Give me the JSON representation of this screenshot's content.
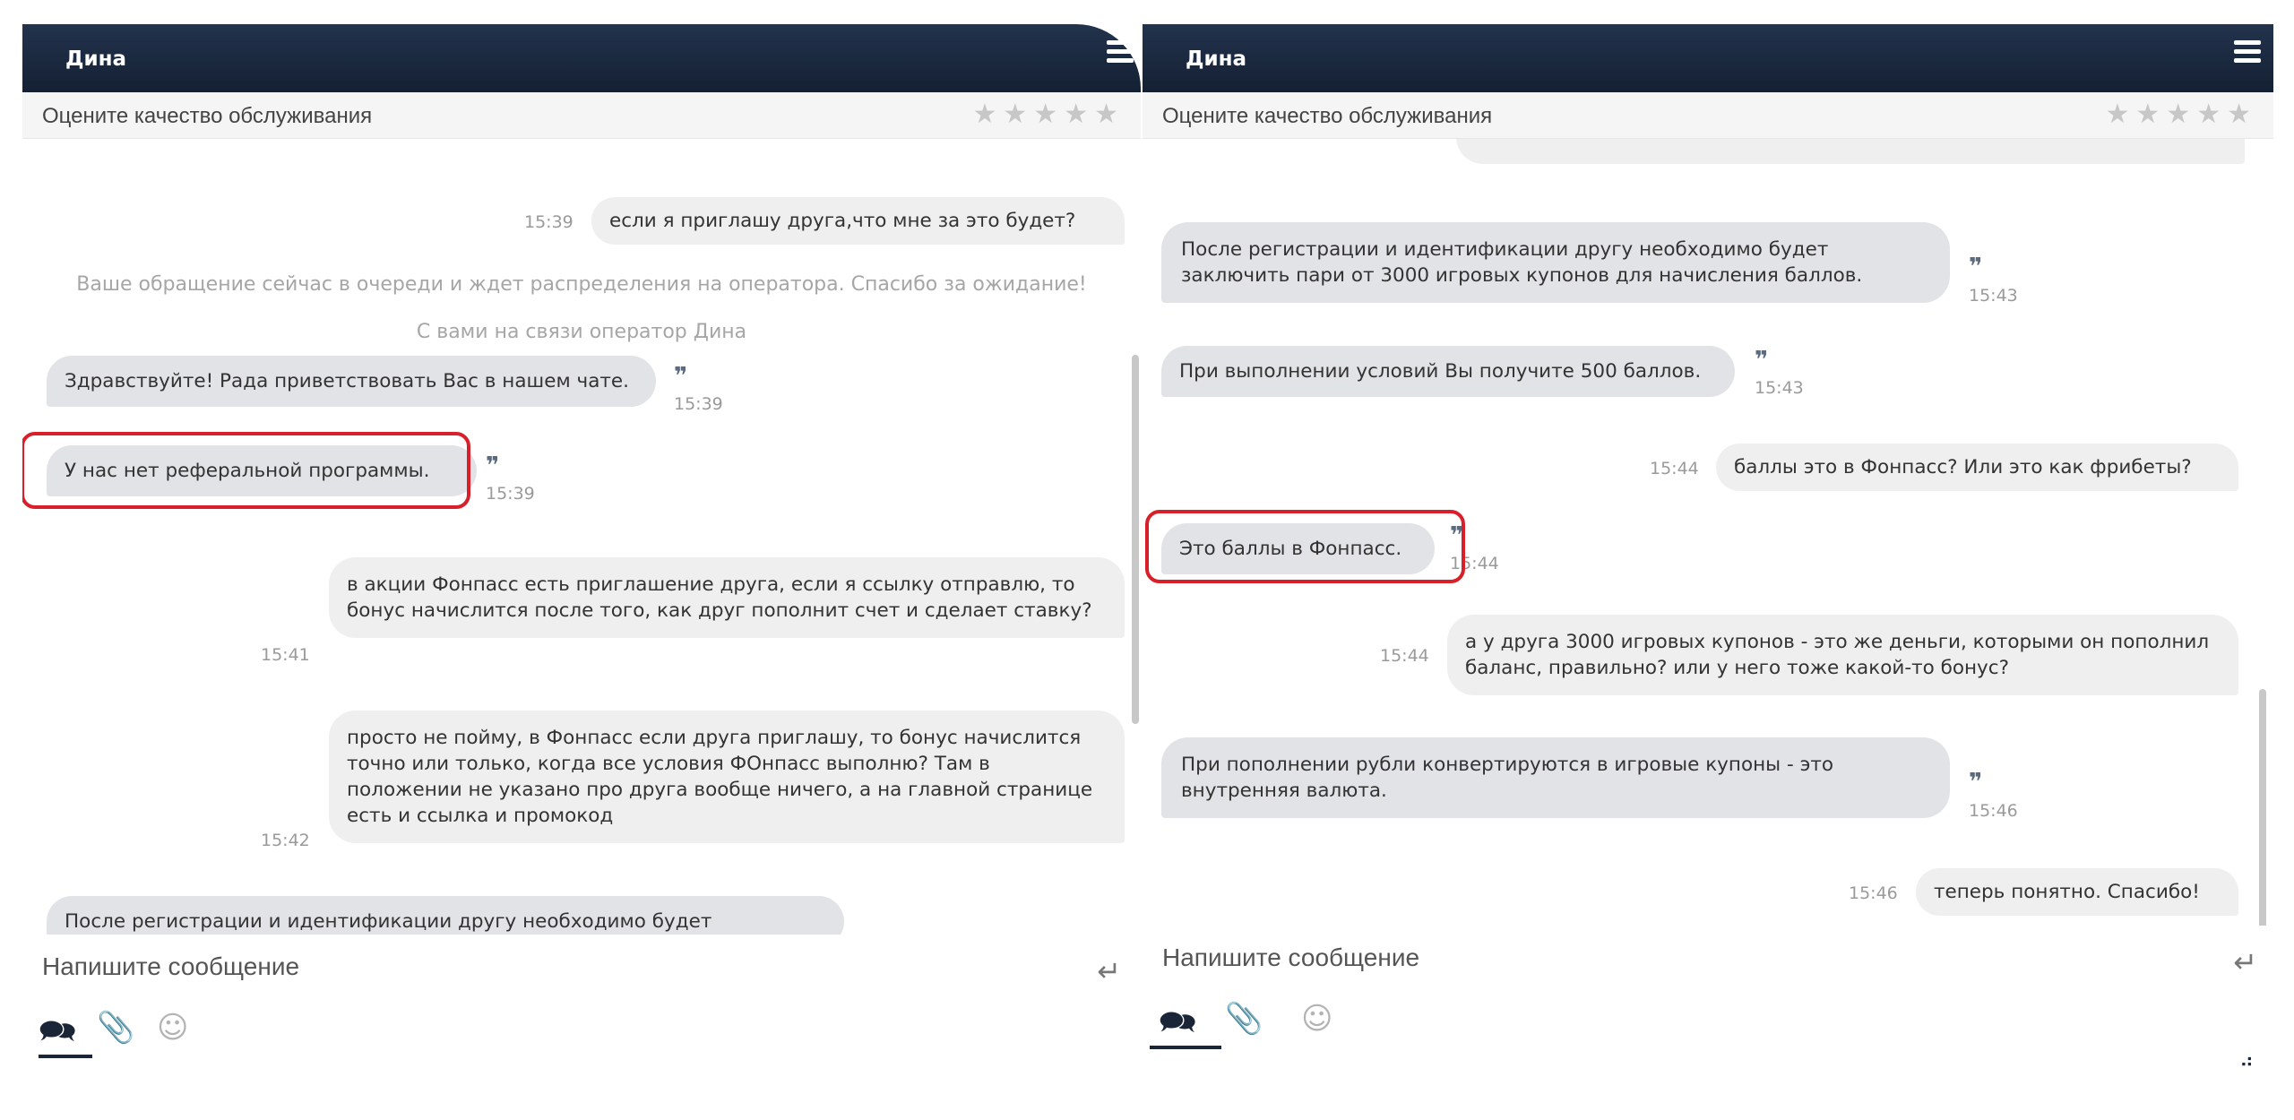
{
  "panels": [
    {
      "operator_name": "Дина",
      "rating_label": "Оцените качество обслуживания",
      "stars": "★★★★★",
      "input_placeholder": "Напишите сообщение",
      "messages": [
        {
          "type": "out",
          "text": "если я приглашу друга,что мне за это будет?",
          "time": "15:39"
        },
        {
          "type": "system",
          "text": "Ваше обращение сейчас в очереди и ждет распределения на оператора. Спасибо за ожидание!"
        },
        {
          "type": "system",
          "text": "С вами на связи оператор Дина"
        },
        {
          "type": "in",
          "text": "Здравствуйте! Рада приветствовать Вас в нашем чате.",
          "time": "15:39"
        },
        {
          "type": "in",
          "text": "У нас нет реферальной программы.",
          "time": "15:39"
        },
        {
          "type": "out",
          "text": "в акции Фонпасс есть приглашение друга, если я ссылку отправлю, то бонус начислится после того, как друг пополнит счет и сделает ставку?",
          "time": "15:41"
        },
        {
          "type": "out",
          "text": "просто не пойму, в Фонпасс если друга приглашу, то бонус начислится точно или только, когда все условия ФОнпасс выполню? Там в положении не указано про друга вообще ничего, а на главной странице есть и ссылка и промокод",
          "time": "15:42"
        },
        {
          "type": "in",
          "text": "После регистрации и идентификации другу необходимо будет"
        }
      ]
    },
    {
      "operator_name": "Дина",
      "rating_label": "Оцените качество обслуживания",
      "stars": "★★★★★",
      "input_placeholder": "Напишите сообщение",
      "messages": [
        {
          "type": "in",
          "text": "После регистрации и идентификации другу необходимо будет заключить пари от 3000 игровых купонов для начисления баллов.",
          "time": "15:43"
        },
        {
          "type": "in",
          "text": "При выполнении условий Вы получите 500 баллов.",
          "time": "15:43"
        },
        {
          "type": "out",
          "text": "баллы это в Фонпасс? Или это как фрибеты?",
          "time": "15:44"
        },
        {
          "type": "in",
          "text": "Это баллы в Фонпасс.",
          "time": "15:44"
        },
        {
          "type": "out",
          "text": "а у друга 3000 игровых купонов - это же деньги, которыми он пополнил баланс, правильно? или у него тоже какой-то бонус?",
          "time": "15:44"
        },
        {
          "type": "in",
          "text": "При пополнении рубли конвертируются в игровые купоны - это внутренняя валюта.",
          "time": "15:46"
        },
        {
          "type": "out",
          "text": "теперь понятно. Спасибо!",
          "time": "15:46"
        }
      ]
    }
  ],
  "icons": {
    "menu": "hamburger-menu-icon",
    "enter": "enter-icon",
    "chat": "chat-bubbles-icon",
    "attach": "paperclip-icon",
    "emoji": "smiley-icon",
    "quote": "quote-icon",
    "resize": "resize-grip-icon"
  },
  "colors": {
    "header": "#1a2538",
    "incoming_bubble": "#e2e3e7",
    "outgoing_bubble": "#efefef",
    "highlight": "#d91f2a"
  }
}
